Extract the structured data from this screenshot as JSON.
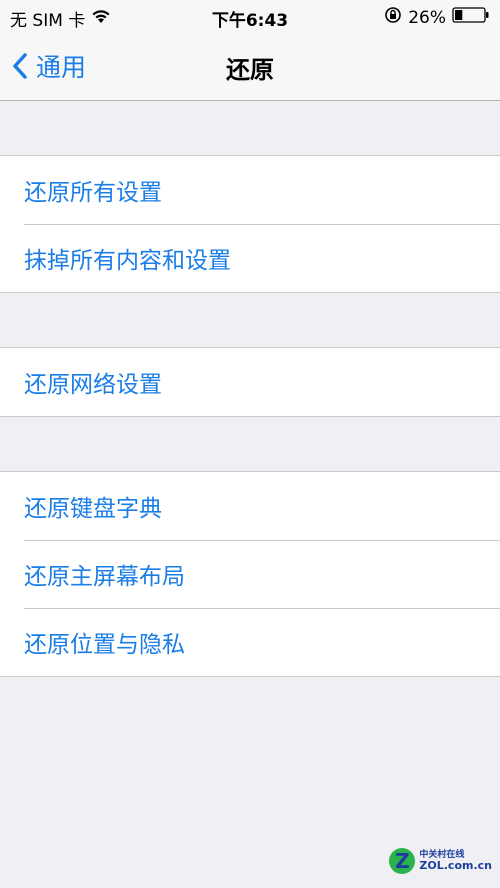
{
  "status_bar": {
    "carrier": "无 SIM 卡",
    "time": "下午6:43",
    "battery_percent": "26%",
    "battery_level": 0.26,
    "icons": [
      "wifi-icon",
      "rotation-lock-icon",
      "battery-icon"
    ]
  },
  "nav": {
    "back_label": "通用",
    "back_icon": "chevron-left-icon",
    "title": "还原"
  },
  "groups": [
    {
      "items": [
        {
          "label": "还原所有设置"
        },
        {
          "label": "抹掉所有内容和设置"
        }
      ]
    },
    {
      "items": [
        {
          "label": "还原网络设置"
        }
      ]
    },
    {
      "items": [
        {
          "label": "还原键盘字典"
        },
        {
          "label": "还原主屏幕布局"
        },
        {
          "label": "还原位置与隐私"
        }
      ]
    }
  ],
  "watermark": {
    "logo_letter": "Z",
    "name_cn": "中关村在线",
    "domain": "ZOL.com.cn"
  },
  "colors": {
    "accent": "#1a7ee6",
    "background": "#efeff4",
    "bar": "#f7f7f7"
  }
}
